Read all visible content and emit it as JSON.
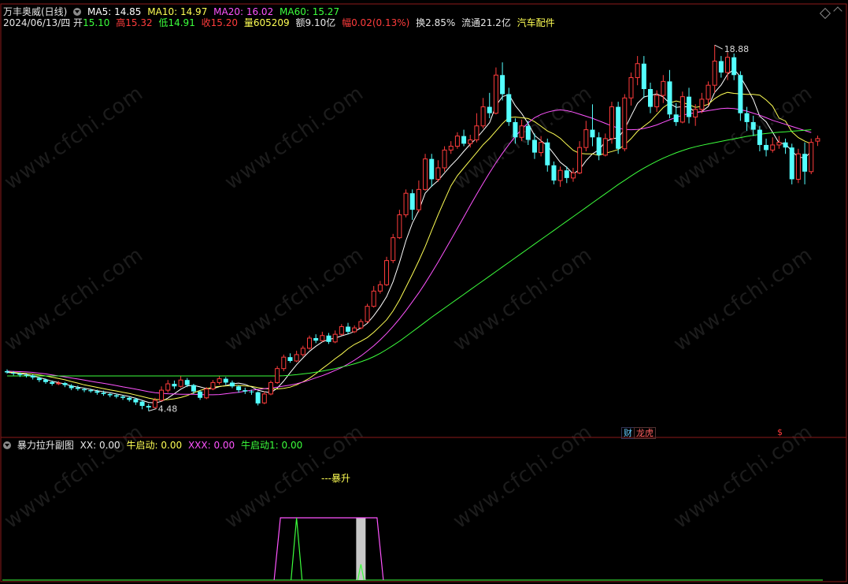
{
  "main_header": {
    "stock_name": "万丰奥威(日线)",
    "ma5": "MA5: 14.85",
    "ma10": "MA10: 14.97",
    "ma20": "MA20: 16.02",
    "ma60": "MA60: 15.27"
  },
  "info_line": {
    "date": "2024/06/13/四",
    "open_label": "开",
    "open": "15.10",
    "high_label": "高",
    "high": "15.32",
    "low_label": "低",
    "low": "14.91",
    "close_label": "收",
    "close": "15.20",
    "volume_label": "量",
    "volume": "605209",
    "amount_label": "额",
    "amount": "9.10亿",
    "change_label": "幅",
    "change": "0.02(0.13%)",
    "turnover": "换2.85%",
    "float": "流通21.2亿",
    "sector": "汽车配件"
  },
  "annotations": {
    "high_marker": "18.88",
    "low_marker": "4.48"
  },
  "badges": {
    "finance": "财",
    "rank": "龙虎",
    "dollar": "$"
  },
  "watermark": "www.cfchi.com",
  "sub_header": {
    "indicator_name": "暴力拉升副图",
    "xx": "XX: 0.00",
    "niu_qidong": "牛启动: 0.00",
    "xxx": "XXX: 0.00",
    "niu_qidong1": "牛启动1: 0.00"
  },
  "sub_annotation": "---暴升",
  "colors": {
    "up": "#ff3c3c",
    "down": "#54ffff",
    "ma5": "#ffffff",
    "ma10": "#ffff54",
    "ma20": "#ff54ff",
    "ma60": "#3cff3c",
    "xxx": "#ff54ff",
    "niu": "#3cff3c"
  },
  "chart_data": {
    "type": "candlestick",
    "y_range": [
      4.0,
      19.6
    ],
    "candles": [
      [
        6.05,
        6.0,
        6.12,
        5.95
      ],
      [
        5.98,
        5.95,
        6.05,
        5.88
      ],
      [
        5.95,
        5.9,
        6.0,
        5.82
      ],
      [
        5.9,
        5.88,
        5.96,
        5.8
      ],
      [
        5.88,
        5.8,
        5.92,
        5.72
      ],
      [
        5.78,
        5.7,
        5.82,
        5.62
      ],
      [
        5.72,
        5.62,
        5.76,
        5.55
      ],
      [
        5.62,
        5.55,
        5.68,
        5.48
      ],
      [
        5.55,
        5.58,
        5.66,
        5.5
      ],
      [
        5.58,
        5.5,
        5.62,
        5.42
      ],
      [
        5.48,
        5.38,
        5.54,
        5.3
      ],
      [
        5.4,
        5.35,
        5.48,
        5.28
      ],
      [
        5.34,
        5.3,
        5.4,
        5.22
      ],
      [
        5.3,
        5.26,
        5.36,
        5.2
      ],
      [
        5.26,
        5.2,
        5.32,
        5.12
      ],
      [
        5.2,
        5.15,
        5.28,
        5.08
      ],
      [
        5.15,
        5.1,
        5.2,
        5.02
      ],
      [
        5.1,
        5.05,
        5.16,
        4.98
      ],
      [
        5.05,
        5.0,
        5.1,
        4.92
      ],
      [
        5.0,
        4.92,
        5.06,
        4.85
      ],
      [
        4.95,
        4.82,
        5.0,
        4.72
      ],
      [
        4.85,
        4.68,
        4.9,
        4.55
      ],
      [
        4.68,
        4.62,
        4.76,
        4.48
      ],
      [
        4.62,
        4.9,
        5.0,
        4.58
      ],
      [
        4.9,
        5.3,
        5.45,
        4.85
      ],
      [
        5.3,
        5.55,
        5.7,
        5.2
      ],
      [
        5.55,
        5.45,
        5.68,
        5.35
      ],
      [
        5.45,
        5.7,
        5.85,
        5.4
      ],
      [
        5.7,
        5.5,
        5.78,
        5.42
      ],
      [
        5.5,
        5.25,
        5.55,
        5.15
      ],
      [
        5.25,
        5.0,
        5.3,
        4.92
      ],
      [
        5.0,
        5.35,
        5.42,
        4.95
      ],
      [
        5.35,
        5.6,
        5.7,
        5.3
      ],
      [
        5.6,
        5.75,
        5.85,
        5.52
      ],
      [
        5.75,
        5.6,
        5.82,
        5.5
      ],
      [
        5.6,
        5.45,
        5.68,
        5.38
      ],
      [
        5.45,
        5.3,
        5.5,
        5.2
      ],
      [
        5.3,
        5.25,
        5.4,
        5.15
      ],
      [
        5.25,
        5.22,
        5.32,
        5.12
      ],
      [
        5.22,
        4.78,
        5.25,
        4.7
      ],
      [
        4.8,
        5.15,
        5.25,
        4.75
      ],
      [
        5.15,
        5.6,
        5.68,
        5.1
      ],
      [
        5.6,
        6.15,
        6.25,
        5.55
      ],
      [
        6.15,
        6.6,
        6.7,
        6.05
      ],
      [
        6.6,
        6.45,
        6.75,
        6.38
      ],
      [
        6.45,
        6.7,
        6.85,
        6.4
      ],
      [
        6.7,
        6.95,
        7.05,
        6.62
      ],
      [
        6.95,
        7.35,
        7.45,
        6.9
      ],
      [
        7.35,
        7.25,
        7.5,
        7.15
      ],
      [
        7.25,
        7.45,
        7.6,
        7.2
      ],
      [
        7.45,
        7.2,
        7.55,
        7.12
      ],
      [
        7.2,
        7.5,
        7.65,
        7.15
      ],
      [
        7.5,
        7.8,
        7.9,
        7.45
      ],
      [
        7.8,
        7.6,
        7.95,
        7.5
      ],
      [
        7.6,
        7.75,
        7.85,
        7.55
      ],
      [
        7.75,
        8.0,
        8.1,
        7.7
      ],
      [
        8.0,
        8.6,
        8.7,
        7.95
      ],
      [
        8.6,
        9.2,
        9.4,
        8.55
      ],
      [
        9.2,
        9.45,
        9.6,
        9.1
      ],
      [
        9.45,
        10.4,
        10.55,
        9.4
      ],
      [
        10.4,
        11.3,
        11.45,
        10.3
      ],
      [
        11.3,
        12.2,
        12.4,
        11.25
      ],
      [
        12.2,
        13.05,
        13.2,
        12.1
      ],
      [
        13.05,
        12.4,
        13.2,
        12.0
      ],
      [
        12.4,
        13.2,
        13.55,
        12.3
      ],
      [
        13.2,
        14.4,
        14.6,
        13.15
      ],
      [
        14.4,
        13.6,
        14.6,
        13.3
      ],
      [
        13.6,
        14.05,
        14.35,
        13.5
      ],
      [
        14.05,
        14.75,
        14.9,
        13.9
      ],
      [
        14.75,
        14.9,
        15.1,
        14.6
      ],
      [
        14.9,
        15.3,
        15.45,
        14.8
      ],
      [
        15.3,
        15.0,
        15.55,
        14.9
      ],
      [
        15.0,
        15.15,
        15.35,
        14.85
      ],
      [
        15.15,
        15.7,
        16.2,
        15.05
      ],
      [
        15.7,
        16.45,
        16.8,
        15.6
      ],
      [
        16.45,
        16.2,
        17.0,
        16.0
      ],
      [
        16.2,
        17.7,
        18.0,
        16.15
      ],
      [
        17.7,
        16.95,
        18.2,
        16.7
      ],
      [
        16.95,
        15.85,
        17.2,
        15.7
      ],
      [
        15.85,
        15.25,
        16.0,
        15.0
      ],
      [
        15.25,
        15.7,
        15.95,
        15.1
      ],
      [
        15.7,
        15.15,
        15.9,
        14.95
      ],
      [
        15.15,
        14.65,
        15.4,
        14.4
      ],
      [
        14.65,
        15.05,
        15.3,
        14.5
      ],
      [
        15.05,
        14.15,
        15.2,
        13.9
      ],
      [
        14.15,
        13.55,
        14.3,
        13.4
      ],
      [
        13.55,
        13.95,
        14.1,
        13.3
      ],
      [
        13.95,
        13.65,
        14.1,
        13.45
      ],
      [
        13.65,
        13.85,
        14.05,
        13.5
      ],
      [
        13.85,
        14.85,
        15.1,
        13.8
      ],
      [
        14.85,
        15.55,
        15.9,
        14.7
      ],
      [
        15.55,
        15.25,
        16.55,
        14.9
      ],
      [
        15.25,
        14.55,
        15.45,
        14.35
      ],
      [
        14.55,
        15.2,
        15.4,
        14.5
      ],
      [
        15.2,
        16.45,
        16.65,
        15.0
      ],
      [
        16.45,
        14.8,
        16.65,
        14.6
      ],
      [
        14.8,
        16.8,
        16.95,
        14.7
      ],
      [
        16.8,
        17.6,
        17.8,
        16.5
      ],
      [
        17.6,
        18.15,
        18.45,
        17.3
      ],
      [
        18.15,
        17.15,
        18.45,
        16.8
      ],
      [
        17.15,
        16.45,
        17.4,
        16.2
      ],
      [
        16.45,
        16.9,
        17.1,
        16.25
      ],
      [
        16.9,
        17.45,
        17.7,
        16.6
      ],
      [
        17.45,
        16.15,
        17.9,
        16.0
      ],
      [
        16.15,
        15.85,
        16.6,
        15.7
      ],
      [
        15.85,
        16.85,
        17.05,
        15.8
      ],
      [
        16.85,
        16.05,
        17.2,
        15.8
      ],
      [
        16.05,
        16.35,
        16.55,
        15.7
      ],
      [
        16.35,
        16.75,
        17.0,
        16.2
      ],
      [
        16.75,
        17.3,
        17.45,
        16.5
      ],
      [
        17.3,
        18.25,
        18.88,
        17.0
      ],
      [
        18.25,
        17.8,
        18.45,
        17.6
      ],
      [
        17.8,
        18.4,
        18.6,
        17.5
      ],
      [
        18.4,
        17.7,
        18.55,
        17.5
      ],
      [
        17.7,
        16.2,
        17.85,
        15.9
      ],
      [
        16.2,
        15.85,
        16.45,
        15.5
      ],
      [
        15.85,
        15.55,
        16.1,
        15.3
      ],
      [
        15.55,
        14.95,
        15.7,
        14.7
      ],
      [
        14.95,
        14.75,
        15.2,
        14.5
      ],
      [
        14.75,
        14.95,
        15.25,
        14.65
      ],
      [
        14.95,
        15.05,
        15.3,
        14.8
      ],
      [
        15.05,
        14.85,
        15.2,
        14.6
      ],
      [
        14.85,
        13.6,
        15.0,
        13.4
      ],
      [
        13.6,
        14.6,
        14.8,
        13.45
      ],
      [
        14.6,
        13.9,
        15.05,
        13.4
      ],
      [
        13.9,
        15.05,
        15.2,
        13.8
      ],
      [
        15.1,
        15.2,
        15.32,
        14.91
      ]
    ],
    "ma_series": [
      {
        "name": "MA5",
        "values": [
          6.0,
          5.98,
          5.95,
          5.92,
          5.86,
          5.8,
          5.73,
          5.65,
          5.6,
          5.54,
          5.47,
          5.42,
          5.38,
          5.33,
          5.28,
          5.24,
          5.2,
          5.15,
          5.1,
          5.05,
          4.98,
          4.9,
          4.82,
          4.8,
          4.86,
          4.99,
          5.16,
          5.34,
          5.47,
          5.49,
          5.43,
          5.36,
          5.36,
          5.44,
          5.48,
          5.55,
          5.58,
          5.53,
          5.43,
          5.3,
          5.24,
          5.2,
          5.38,
          5.66,
          5.99,
          6.3,
          6.57,
          6.83,
          7.03,
          7.2,
          7.3,
          7.35,
          7.44,
          7.51,
          7.61,
          7.75,
          7.93,
          8.23,
          8.58,
          8.98,
          9.57,
          10.33,
          11.18,
          11.87,
          12.37,
          13.05,
          13.33,
          13.55,
          13.85,
          14.14,
          14.4,
          14.7,
          14.98,
          15.22,
          15.52,
          15.83,
          16.5,
          16.85,
          16.94,
          16.5,
          16.19,
          15.79,
          15.33,
          15.12,
          14.92,
          14.6,
          14.27,
          14.07,
          13.81,
          13.98,
          14.33,
          14.6,
          14.76,
          15.08,
          15.19,
          15.23,
          15.57,
          16.09,
          16.59,
          16.84,
          16.9,
          16.96,
          16.84,
          16.59,
          16.43,
          16.46,
          16.45,
          16.23,
          16.27,
          16.46,
          17.02,
          17.31,
          17.73,
          17.93,
          17.63,
          17.2,
          16.74,
          16.08,
          15.86,
          15.45,
          15.03,
          14.99,
          14.71,
          14.47,
          14.44,
          14.69
        ]
      },
      {
        "name": "MA10",
        "values": [
          6.02,
          6.0,
          5.98,
          5.96,
          5.93,
          5.9,
          5.86,
          5.81,
          5.76,
          5.71,
          5.64,
          5.58,
          5.51,
          5.46,
          5.41,
          5.36,
          5.31,
          5.27,
          5.22,
          5.17,
          5.11,
          5.05,
          4.99,
          4.94,
          4.92,
          4.93,
          4.96,
          5.01,
          5.09,
          5.2,
          5.29,
          5.36,
          5.41,
          5.45,
          5.47,
          5.49,
          5.49,
          5.47,
          5.45,
          5.4,
          5.36,
          5.35,
          5.35,
          5.37,
          5.42,
          5.51,
          5.63,
          5.77,
          5.95,
          6.15,
          6.34,
          6.54,
          6.72,
          6.93,
          7.1,
          7.23,
          7.37,
          7.58,
          7.82,
          8.07,
          8.42,
          8.85,
          9.35,
          9.86,
          10.39,
          10.95,
          11.58,
          12.2,
          12.78,
          13.34,
          13.74,
          14.05,
          14.35,
          14.65,
          14.96,
          15.21,
          15.5,
          15.79,
          16.03,
          16.05,
          16.02,
          15.99,
          15.87,
          15.69,
          15.5,
          15.38,
          15.21,
          14.97,
          14.74,
          14.62,
          14.6,
          14.6,
          14.54,
          14.63,
          14.69,
          14.77,
          14.95,
          15.2,
          15.49,
          15.69,
          15.88,
          16.15,
          16.42,
          16.6,
          16.68,
          16.62,
          16.54,
          16.43,
          16.47,
          16.55,
          16.77,
          16.93,
          17.02,
          16.98,
          16.96,
          16.94,
          16.94,
          16.91,
          16.72,
          16.48,
          16.01,
          15.89,
          15.47,
          15.24,
          15.1,
          14.99
        ]
      },
      {
        "name": "MA20",
        "values": [
          6.05,
          6.04,
          6.03,
          6.02,
          6.0,
          5.97,
          5.94,
          5.9,
          5.86,
          5.82,
          5.78,
          5.74,
          5.7,
          5.65,
          5.61,
          5.57,
          5.53,
          5.48,
          5.43,
          5.39,
          5.34,
          5.29,
          5.24,
          5.2,
          5.18,
          5.16,
          5.15,
          5.14,
          5.14,
          5.14,
          5.13,
          5.12,
          5.12,
          5.13,
          5.16,
          5.19,
          5.22,
          5.26,
          5.3,
          5.33,
          5.36,
          5.39,
          5.42,
          5.46,
          5.5,
          5.55,
          5.62,
          5.7,
          5.79,
          5.87,
          5.97,
          6.08,
          6.19,
          6.33,
          6.48,
          6.65,
          6.84,
          7.05,
          7.28,
          7.53,
          7.81,
          8.11,
          8.43,
          8.78,
          9.13,
          9.51,
          9.92,
          10.34,
          10.78,
          11.22,
          11.67,
          12.12,
          12.57,
          13.01,
          13.44,
          13.86,
          14.25,
          14.62,
          14.97,
          15.28,
          15.57,
          15.82,
          16.02,
          16.15,
          16.24,
          16.3,
          16.33,
          16.3,
          16.24,
          16.16,
          16.08,
          16.0,
          15.9,
          15.8,
          15.7,
          15.62,
          15.56,
          15.55,
          15.56,
          15.6,
          15.66,
          15.74,
          15.84,
          15.94,
          16.04,
          16.12,
          16.18,
          16.22,
          16.26,
          16.3,
          16.34,
          16.38,
          16.4,
          16.38,
          16.34,
          16.28,
          16.2,
          16.12,
          16.02,
          15.92,
          15.84,
          15.76,
          15.68,
          15.6,
          15.52,
          15.44
        ]
      },
      {
        "name": "MA60",
        "values": [
          5.86,
          5.86,
          5.86,
          5.86,
          5.86,
          5.86,
          5.86,
          5.86,
          5.86,
          5.86,
          5.86,
          5.86,
          5.86,
          5.86,
          5.86,
          5.86,
          5.86,
          5.86,
          5.86,
          5.86,
          5.86,
          5.86,
          5.86,
          5.86,
          5.86,
          5.86,
          5.86,
          5.86,
          5.86,
          5.86,
          5.86,
          5.86,
          5.86,
          5.86,
          5.86,
          5.86,
          5.86,
          5.86,
          5.86,
          5.86,
          5.86,
          5.86,
          5.86,
          5.87,
          5.89,
          5.91,
          5.94,
          5.97,
          6.01,
          6.05,
          6.1,
          6.15,
          6.21,
          6.27,
          6.34,
          6.42,
          6.51,
          6.62,
          6.75,
          6.9,
          7.06,
          7.23,
          7.41,
          7.6,
          7.79,
          7.98,
          8.17,
          8.35,
          8.53,
          8.71,
          8.89,
          9.07,
          9.25,
          9.43,
          9.61,
          9.79,
          9.97,
          10.15,
          10.33,
          10.51,
          10.69,
          10.87,
          11.05,
          11.23,
          11.41,
          11.59,
          11.77,
          11.95,
          12.13,
          12.31,
          12.49,
          12.67,
          12.85,
          13.03,
          13.21,
          13.39,
          13.56,
          13.73,
          13.89,
          14.04,
          14.18,
          14.31,
          14.43,
          14.54,
          14.64,
          14.73,
          14.81,
          14.88,
          14.94,
          14.99,
          15.04,
          15.09,
          15.14,
          15.19,
          15.24,
          15.29,
          15.33,
          15.37,
          15.4,
          15.43,
          15.45,
          15.47,
          15.49,
          15.51,
          15.53,
          15.55
        ]
      }
    ],
    "sub_chart": {
      "y_range": [
        0,
        1
      ],
      "xxx_start": 42,
      "xxx_end": 58,
      "niu_peak": 45,
      "gray_bar": 55
    }
  }
}
